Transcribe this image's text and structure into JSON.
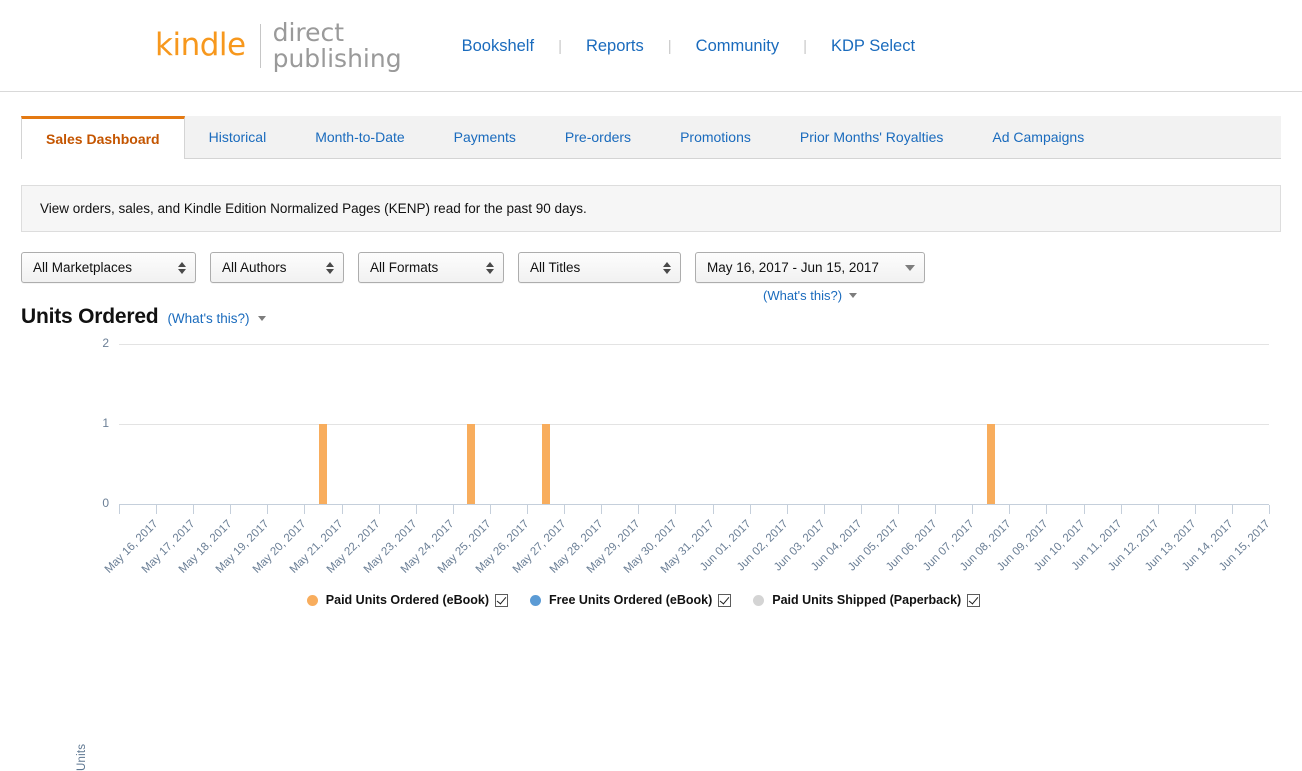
{
  "brand": {
    "kindle": "kindle",
    "direct": "direct",
    "publishing": "publishing"
  },
  "topnav": {
    "separator": "|",
    "items": [
      {
        "label": "Bookshelf"
      },
      {
        "label": "Reports"
      },
      {
        "label": "Community"
      },
      {
        "label": "KDP Select"
      }
    ]
  },
  "tabs": [
    {
      "label": "Sales Dashboard",
      "active": true
    },
    {
      "label": "Historical",
      "active": false
    },
    {
      "label": "Month-to-Date",
      "active": false
    },
    {
      "label": "Payments",
      "active": false
    },
    {
      "label": "Pre-orders",
      "active": false
    },
    {
      "label": "Promotions",
      "active": false
    },
    {
      "label": "Prior Months' Royalties",
      "active": false
    },
    {
      "label": "Ad Campaigns",
      "active": false
    }
  ],
  "notice": {
    "text": "View orders, sales, and Kindle Edition Normalized Pages (KENP) read for the past 90 days."
  },
  "filters": {
    "marketplace": {
      "value": "All Marketplaces"
    },
    "author": {
      "value": "All Authors"
    },
    "format": {
      "value": "All Formats"
    },
    "title": {
      "value": "All Titles"
    },
    "date_range": {
      "value": "May 16, 2017 - Jun 15, 2017"
    },
    "whats_this": "(What's this?)"
  },
  "chart_header": {
    "title": "Units Ordered",
    "whats_this": "(What's this?)"
  },
  "legend": [
    {
      "label": "Paid Units Ordered (eBook)",
      "color": "#f8ad5d",
      "checked": true
    },
    {
      "label": "Free Units Ordered (eBook)",
      "color": "#5b9bd5",
      "checked": true
    },
    {
      "label": "Paid Units Shipped (Paperback)",
      "color": "#d4d4d4",
      "checked": true
    }
  ],
  "chart_data": {
    "type": "bar",
    "title": "Units Ordered",
    "xlabel": "",
    "ylabel": "Units",
    "ylim": [
      0,
      2
    ],
    "yticks": [
      0,
      1,
      2
    ],
    "grid": true,
    "legend_position": "bottom",
    "categories": [
      "May 16, 2017",
      "May 17, 2017",
      "May 18, 2017",
      "May 19, 2017",
      "May 20, 2017",
      "May 21, 2017",
      "May 22, 2017",
      "May 23, 2017",
      "May 24, 2017",
      "May 25, 2017",
      "May 26, 2017",
      "May 27, 2017",
      "May 28, 2017",
      "May 29, 2017",
      "May 30, 2017",
      "May 31, 2017",
      "Jun 01, 2017",
      "Jun 02, 2017",
      "Jun 03, 2017",
      "Jun 04, 2017",
      "Jun 05, 2017",
      "Jun 06, 2017",
      "Jun 07, 2017",
      "Jun 08, 2017",
      "Jun 09, 2017",
      "Jun 10, 2017",
      "Jun 11, 2017",
      "Jun 12, 2017",
      "Jun 13, 2017",
      "Jun 14, 2017",
      "Jun 15, 2017"
    ],
    "series": [
      {
        "name": "Paid Units Ordered (eBook)",
        "color": "#f8ad5d",
        "values": [
          0,
          0,
          0,
          0,
          0,
          1,
          0,
          0,
          0,
          1,
          0,
          1,
          0,
          0,
          0,
          0,
          0,
          0,
          0,
          0,
          0,
          0,
          0,
          1,
          0,
          0,
          0,
          0,
          0,
          0,
          0
        ]
      },
      {
        "name": "Free Units Ordered (eBook)",
        "color": "#5b9bd5",
        "values": [
          0,
          0,
          0,
          0,
          0,
          0,
          0,
          0,
          0,
          0,
          0,
          0,
          0,
          0,
          0,
          0,
          0,
          0,
          0,
          0,
          0,
          0,
          0,
          0,
          0,
          0,
          0,
          0,
          0,
          0,
          0
        ]
      },
      {
        "name": "Paid Units Shipped (Paperback)",
        "color": "#d4d4d4",
        "values": [
          0,
          0,
          0,
          0,
          0,
          0,
          0,
          0,
          0,
          0,
          0,
          0,
          0,
          0,
          0,
          0,
          0,
          0,
          0,
          0,
          0,
          0,
          0,
          0,
          0,
          0,
          0,
          0,
          0,
          0,
          0
        ]
      }
    ]
  }
}
